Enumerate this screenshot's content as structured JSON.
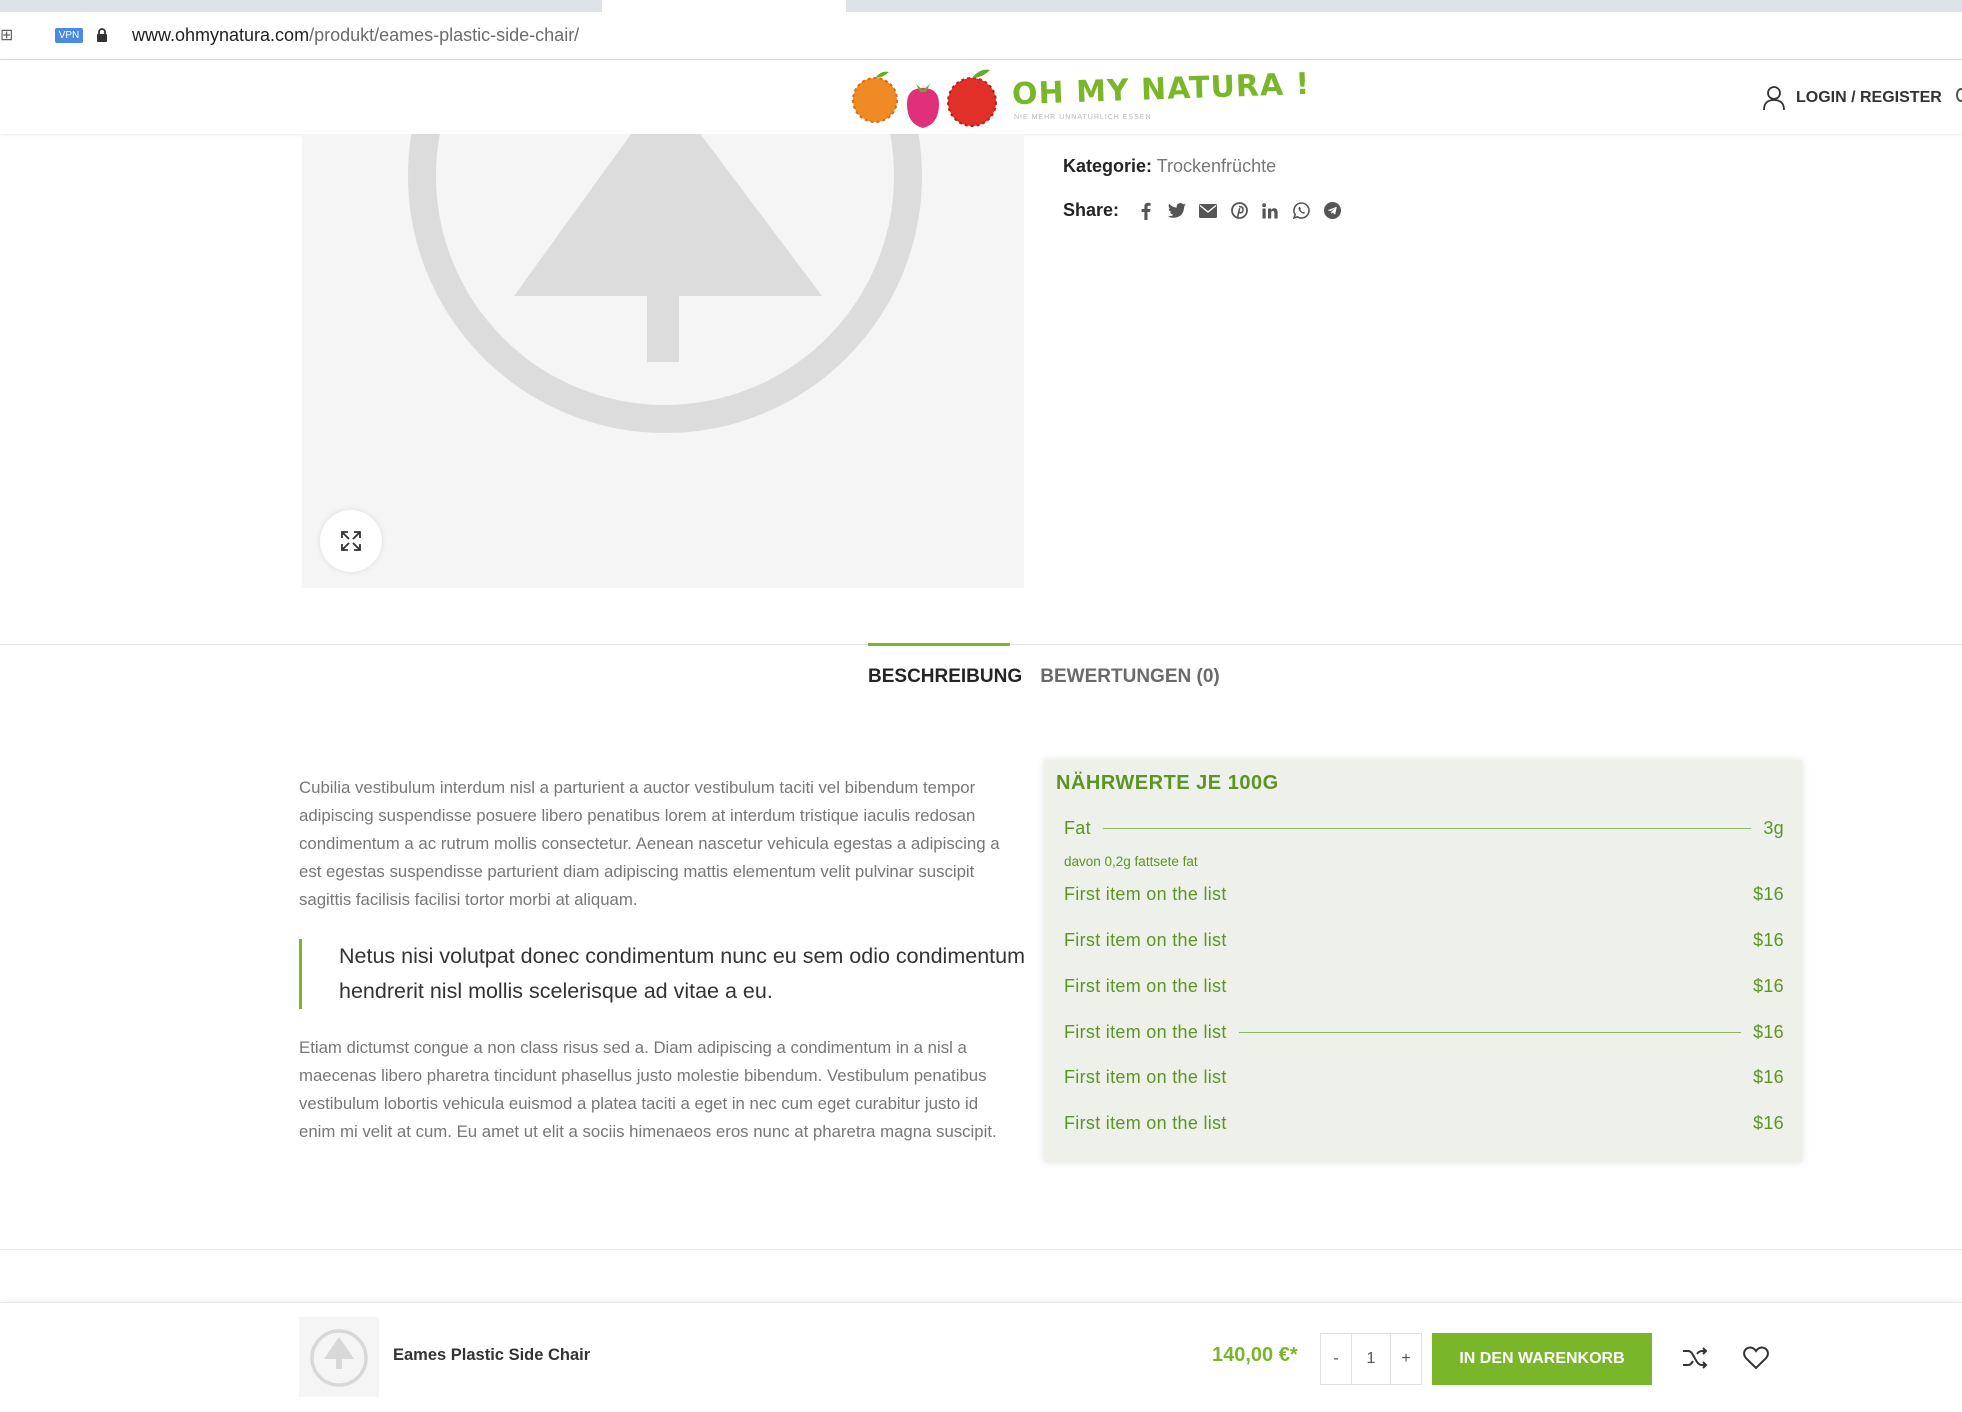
{
  "browser": {
    "url_host": "www.ohmynatura.com",
    "url_path": "/produkt/eames-plastic-side-chair/",
    "vpn_label": "VPN"
  },
  "header": {
    "logo_text": "OH MY NATURA !",
    "logo_tagline": "NIE MEHR UNNATÜRLICH ESSEN",
    "login_label": "LOGIN / REGISTER"
  },
  "product_meta": {
    "category_label": "Kategorie:",
    "category_value": "Trockenfrüchte",
    "share_label": "Share:",
    "share_icons": [
      "facebook-icon",
      "twitter-icon",
      "email-icon",
      "pinterest-icon",
      "linkedin-icon",
      "whatsapp-icon",
      "telegram-icon"
    ]
  },
  "tabs": [
    {
      "label": "BESCHREIBUNG",
      "active": true
    },
    {
      "label": "BEWERTUNGEN (0)",
      "active": false
    }
  ],
  "description": {
    "paragraph1": "Cubilia vestibulum interdum nisl a parturient a auctor vestibulum taciti vel bibendum tempor adipiscing suspendisse posuere libero penatibus lorem at interdum tristique iaculis redosan condimentum a ac rutrum mollis consectetur. Aenean nascetur vehicula egestas a adipiscing a est egestas suspendisse parturient diam adipiscing mattis elementum velit pulvinar suscipit sagittis facilisis facilisi tortor morbi at aliquam.",
    "quote": "Netus nisi volutpat donec condimentum nunc eu sem odio condimentum hendrerit nisl mollis scelerisque ad vitae a eu.",
    "paragraph2": "Etiam dictumst congue a non class risus sed a. Diam adipiscing a condimentum in a nisl a maecenas libero pharetra tincidunt phasellus justo molestie bibendum. Vestibulum penatibus vestibulum lobortis vehicula euismod a platea taciti a eget in nec cum eget curabitur justo id enim mi velit at cum. Eu amet ut elit a sociis himenaeos eros nunc at pharetra magna suscipit."
  },
  "nutrition": {
    "title": "NÄHRWERTE JE 100G",
    "rows": [
      {
        "name": "Fat",
        "value": "3g"
      },
      {
        "name": "First item on the list",
        "value": "$16"
      },
      {
        "name": "First item on the list",
        "value": "$16"
      },
      {
        "name": "First item on the list",
        "value": "$16"
      },
      {
        "name": "First item on the list",
        "value": "$16"
      },
      {
        "name": "First item on the list",
        "value": "$16"
      },
      {
        "name": "First item on the list",
        "value": "$16"
      }
    ],
    "subnote": "davon 0,2g fattsete fat"
  },
  "sticky_bar": {
    "product_name": "Eames Plastic Side Chair",
    "price": "140,00 €*",
    "qty_minus": "-",
    "qty_value": "1",
    "qty_plus": "+",
    "add_to_cart": "IN DEN WARENKORB"
  },
  "colors": {
    "accent": "#7ab629",
    "nutrition_text": "#5a9626",
    "nutrition_bg": "#eef0ea"
  }
}
